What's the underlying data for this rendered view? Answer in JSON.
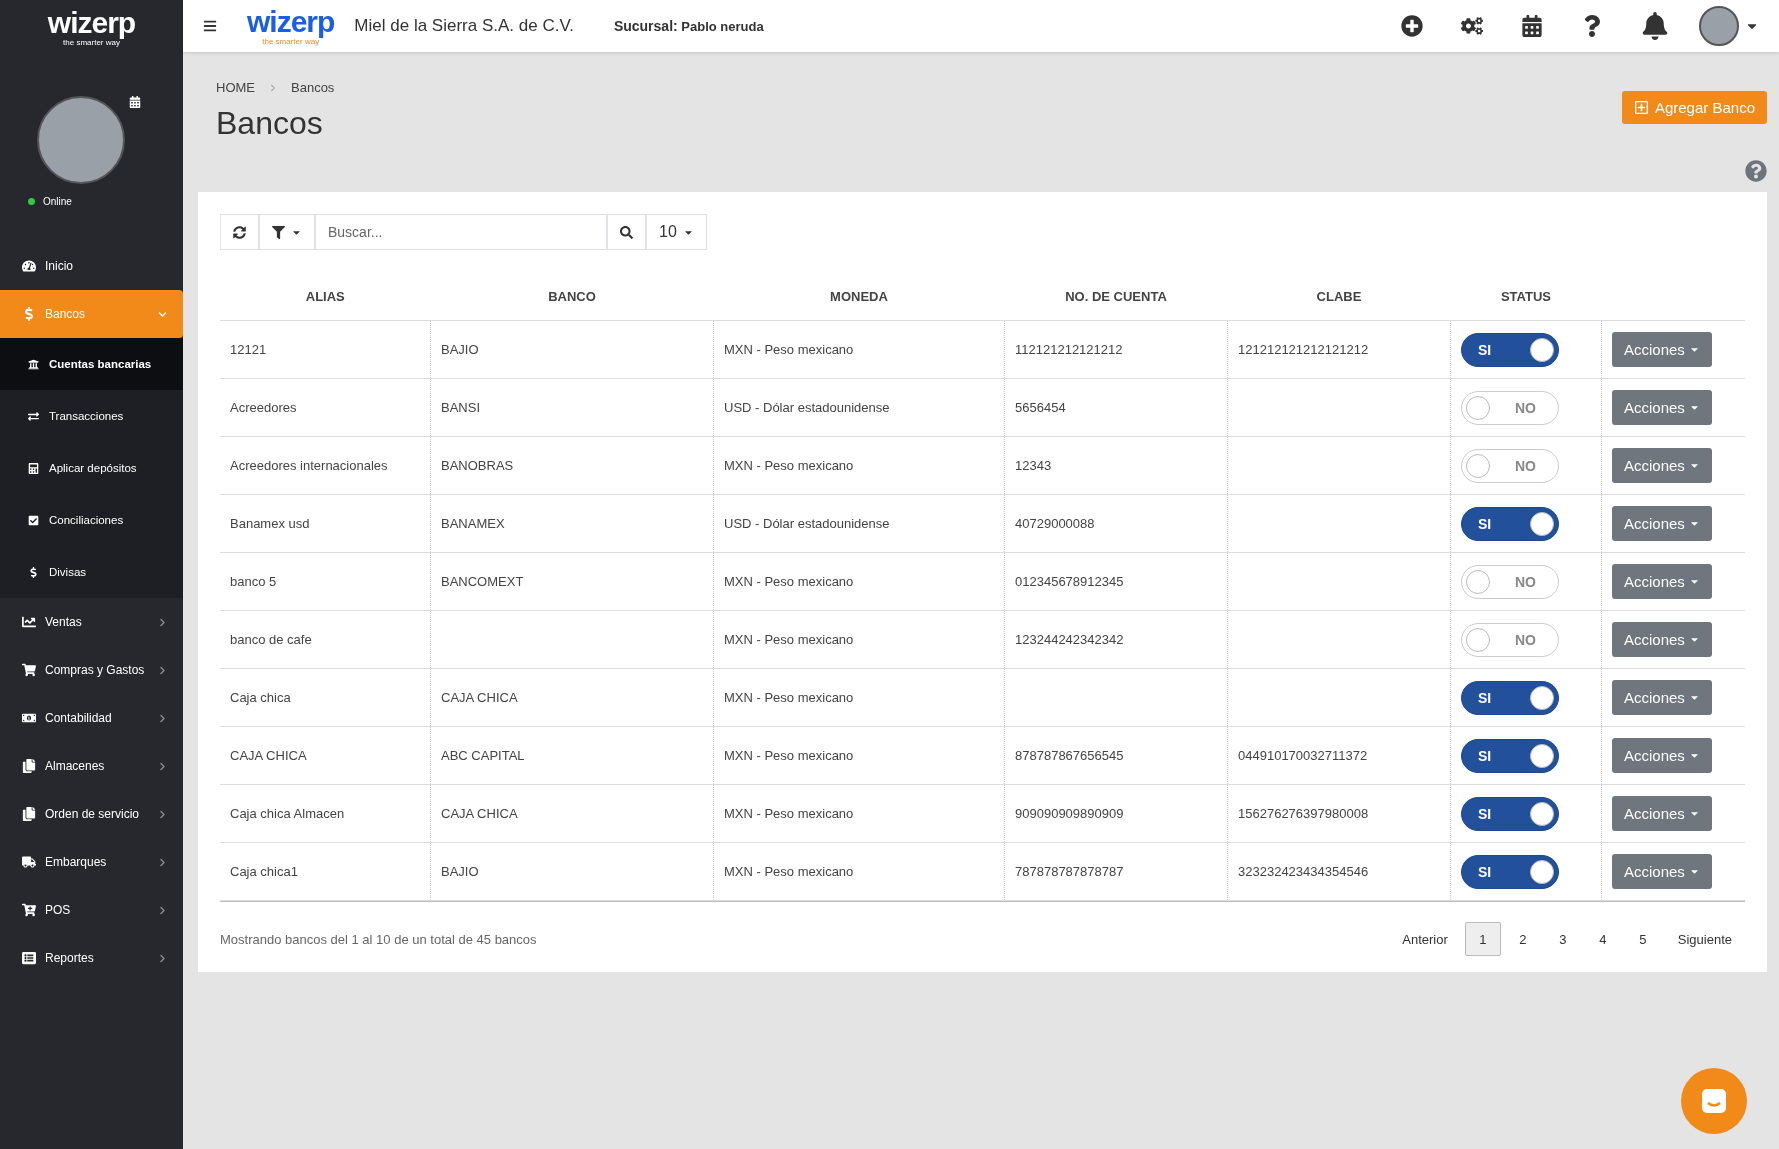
{
  "sidebar": {
    "logo": {
      "name": "wizerp",
      "tagline": "the smarter way"
    },
    "user": {
      "status": "Online",
      "online": true
    },
    "menu": [
      {
        "label": "Inicio",
        "selected": false
      },
      {
        "label": "Bancos",
        "selected": true,
        "expanded": true,
        "children": [
          {
            "label": "Cuentas bancarias",
            "selected": true
          },
          {
            "label": "Transacciones",
            "selected": false
          },
          {
            "label": "Aplicar depósitos",
            "selected": false
          },
          {
            "label": "Conciliaciones",
            "selected": false
          },
          {
            "label": "Divisas",
            "selected": false
          }
        ]
      },
      {
        "label": "Ventas",
        "selected": false,
        "expanded": false
      },
      {
        "label": "Compras y Gastos",
        "selected": false,
        "expanded": false
      },
      {
        "label": "Contabilidad",
        "selected": false,
        "expanded": false
      },
      {
        "label": "Almacenes",
        "selected": false,
        "expanded": false
      },
      {
        "label": "Orden de servicio",
        "selected": false,
        "expanded": false
      },
      {
        "label": "Embarques",
        "selected": false,
        "expanded": false
      },
      {
        "label": "POS",
        "selected": false,
        "expanded": false
      },
      {
        "label": "Reportes",
        "selected": false,
        "expanded": false
      }
    ]
  },
  "header": {
    "logo": {
      "name": "wizerp",
      "tagline": "the smarter way"
    },
    "company": "Miel de la Sierra S.A. de C.V.",
    "branch_label": "Sucursal:",
    "branch": "Pablo neruda"
  },
  "breadcrumb": [
    "HOME",
    "Bancos"
  ],
  "page_title": "Bancos",
  "add_button": "Agregar Banco",
  "toolbar": {
    "search_placeholder": "Buscar...",
    "page_size": "10"
  },
  "table": {
    "columns": [
      "ALIAS",
      "BANCO",
      "MONEDA",
      "NO. DE CUENTA",
      "CLABE",
      "STATUS"
    ],
    "rows": [
      {
        "alias": "12121",
        "banco": "BAJIO",
        "moneda": "MXN - Peso mexicano",
        "cuenta": "112121212121212",
        "clabe": "121212121212121212",
        "on": true,
        "status": "SI",
        "action": "Acciones"
      },
      {
        "alias": "Acreedores",
        "banco": "BANSI",
        "moneda": "USD - Dólar estadounidense",
        "cuenta": "5656454",
        "clabe": "",
        "on": false,
        "status": "NO",
        "action": "Acciones"
      },
      {
        "alias": "Acreedores internacionales",
        "banco": "BANOBRAS",
        "moneda": "MXN - Peso mexicano",
        "cuenta": "12343",
        "clabe": "",
        "on": false,
        "status": "NO",
        "action": "Acciones"
      },
      {
        "alias": "Banamex usd",
        "banco": "BANAMEX",
        "moneda": "USD - Dólar estadounidense",
        "cuenta": "40729000088",
        "clabe": "",
        "on": true,
        "status": "SI",
        "action": "Acciones"
      },
      {
        "alias": "banco 5",
        "banco": "BANCOMEXT",
        "moneda": "MXN - Peso mexicano",
        "cuenta": "012345678912345",
        "clabe": "",
        "on": false,
        "status": "NO",
        "action": "Acciones"
      },
      {
        "alias": "banco de cafe",
        "banco": "",
        "moneda": "MXN - Peso mexicano",
        "cuenta": "123244242342342",
        "clabe": "",
        "on": false,
        "status": "NO",
        "action": "Acciones"
      },
      {
        "alias": "Caja chica",
        "banco": "CAJA CHICA",
        "moneda": "MXN - Peso mexicano",
        "cuenta": "",
        "clabe": "",
        "on": true,
        "status": "SI",
        "action": "Acciones"
      },
      {
        "alias": "CAJA CHICA",
        "banco": "ABC CAPITAL",
        "moneda": "MXN - Peso mexicano",
        "cuenta": "878787867656545",
        "clabe": "044910170032711372",
        "on": true,
        "status": "SI",
        "action": "Acciones"
      },
      {
        "alias": "Caja chica Almacen",
        "banco": "CAJA CHICA",
        "moneda": "MXN - Peso mexicano",
        "cuenta": "909090909890909",
        "clabe": "156276276397980008",
        "on": true,
        "status": "SI",
        "action": "Acciones"
      },
      {
        "alias": "Caja chica1",
        "banco": "BAJIO",
        "moneda": "MXN - Peso mexicano",
        "cuenta": "787878787878787",
        "clabe": "323232423434354546",
        "on": true,
        "status": "SI",
        "action": "Acciones"
      }
    ]
  },
  "footer": {
    "summary": "Mostrando bancos del 1 al 10 de un total de 45 bancos",
    "previous": "Anterior",
    "next": "Siguiente",
    "pages": [
      {
        "label": "1",
        "selected": true
      },
      {
        "label": "2",
        "selected": false
      },
      {
        "label": "3",
        "selected": false
      },
      {
        "label": "4",
        "selected": false
      },
      {
        "label": "5",
        "selected": false
      }
    ]
  }
}
